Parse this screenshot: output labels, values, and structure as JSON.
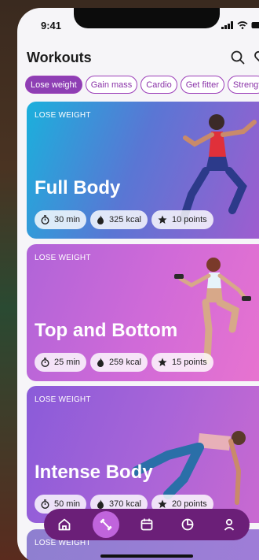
{
  "status": {
    "time": "9:41"
  },
  "header": {
    "title": "Workouts"
  },
  "filters": [
    "Lose weight",
    "Gain mass",
    "Cardio",
    "Get fitter",
    "Strengt"
  ],
  "cards": [
    {
      "tag": "LOSE WEIGHT",
      "name": "Full Body",
      "duration": "30 min",
      "kcal": "325 kcal",
      "points": "10 points"
    },
    {
      "tag": "LOSE WEIGHT",
      "name": "Top and Bottom",
      "duration": "25 min",
      "kcal": "259 kcal",
      "points": "15 points"
    },
    {
      "tag": "LOSE WEIGHT",
      "name": "Intense Body",
      "duration": "50 min",
      "kcal": "370 kcal",
      "points": "20 points"
    },
    {
      "tag": "LOSE WEIGHT"
    }
  ],
  "tabs": [
    "home-icon",
    "workouts-icon",
    "calendar-icon",
    "stats-icon",
    "profile-icon"
  ],
  "colors": {
    "accent": "#8e3fb4",
    "tabbar": "#6b1f78"
  }
}
